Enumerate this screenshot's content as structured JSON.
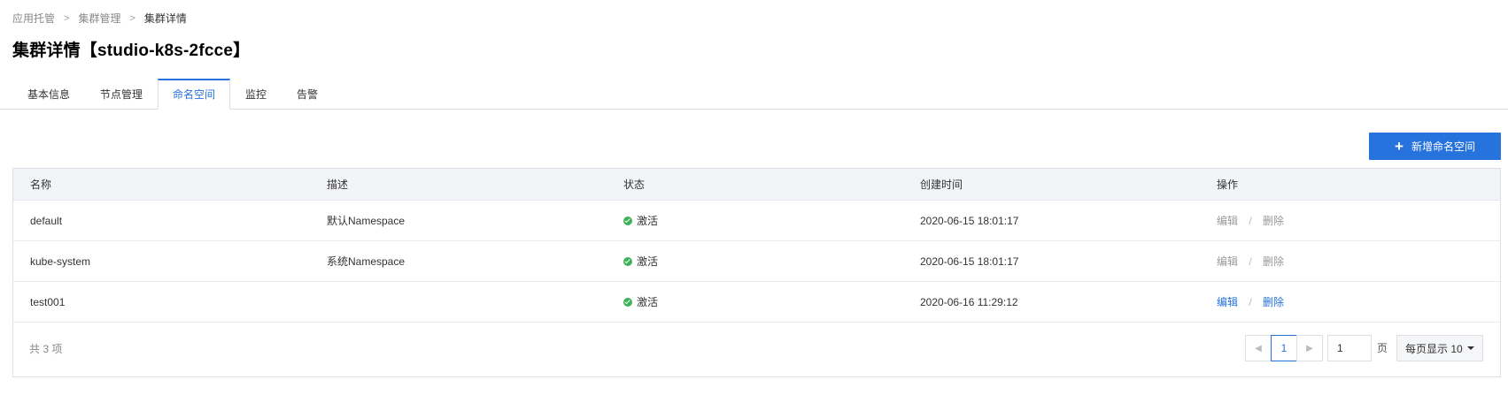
{
  "breadcrumb": {
    "items": [
      "应用托管",
      "集群管理",
      "集群详情"
    ],
    "separator": ">"
  },
  "page": {
    "title": "集群详情【studio-k8s-2fcce】"
  },
  "tabs": [
    {
      "label": "基本信息",
      "active": false
    },
    {
      "label": "节点管理",
      "active": false
    },
    {
      "label": "命名空间",
      "active": true
    },
    {
      "label": "监控",
      "active": false
    },
    {
      "label": "告警",
      "active": false
    }
  ],
  "toolbar": {
    "add_label": "新增命名空间",
    "add_icon": "plus-icon"
  },
  "table": {
    "columns": [
      "名称",
      "描述",
      "状态",
      "创建时间",
      "操作"
    ],
    "rows": [
      {
        "name": "default",
        "description": "默认Namespace",
        "status": "激活",
        "created": "2020-06-15 18:01:17",
        "edit": "编辑",
        "delete": "删除",
        "actions_enabled": false
      },
      {
        "name": "kube-system",
        "description": "系统Namespace",
        "status": "激活",
        "created": "2020-06-15 18:01:17",
        "edit": "编辑",
        "delete": "删除",
        "actions_enabled": false
      },
      {
        "name": "test001",
        "description": "",
        "status": "激活",
        "created": "2020-06-16 11:29:12",
        "edit": "编辑",
        "delete": "删除",
        "actions_enabled": true
      }
    ],
    "action_separator": "/"
  },
  "footer": {
    "total_text": "共 3 项",
    "current_page": "1",
    "page_input_value": "1",
    "page_unit": "页",
    "page_size_label": "每页显示 10",
    "prev_icon": "chevron-left-icon",
    "next_icon": "chevron-right-icon"
  },
  "colors": {
    "accent": "#2673dd",
    "status_active": "#3fb15a",
    "header_bg": "#f2f4f7"
  }
}
